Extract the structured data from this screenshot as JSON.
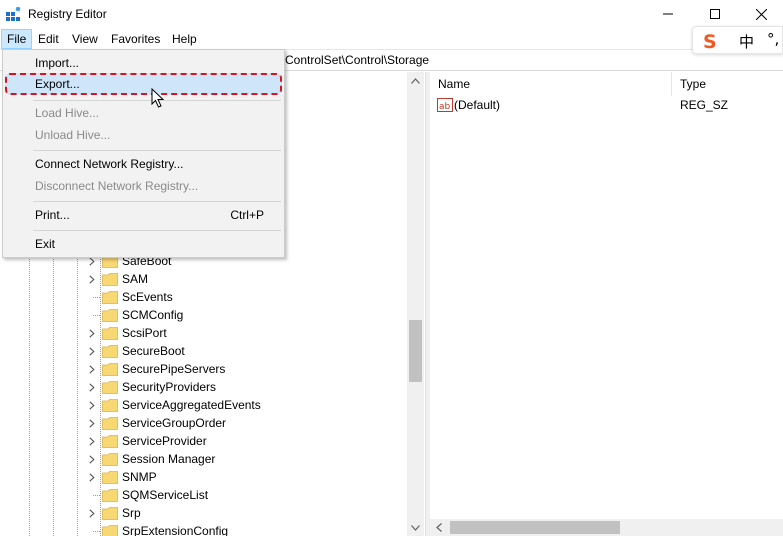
{
  "window": {
    "title": "Registry Editor"
  },
  "menubar": {
    "items": [
      "File",
      "Edit",
      "View",
      "Favorites",
      "Help"
    ]
  },
  "ime": {
    "logo": "S",
    "mode": "中",
    "punct": "°,"
  },
  "address": {
    "path_visible": "ControlSet\\Control\\Storage"
  },
  "file_menu": {
    "import": "Import...",
    "export": "Export...",
    "load_hive": "Load Hive...",
    "unload_hive": "Unload Hive...",
    "connect": "Connect Network Registry...",
    "disconnect": "Disconnect Network Registry...",
    "print": "Print...",
    "print_shortcut": "Ctrl+P",
    "exit": "Exit"
  },
  "tree": {
    "items": [
      {
        "label": "SafeBoot",
        "expandable": true
      },
      {
        "label": "SAM",
        "expandable": true
      },
      {
        "label": "ScEvents",
        "expandable": false
      },
      {
        "label": "SCMConfig",
        "expandable": false
      },
      {
        "label": "ScsiPort",
        "expandable": true
      },
      {
        "label": "SecureBoot",
        "expandable": true
      },
      {
        "label": "SecurePipeServers",
        "expandable": true
      },
      {
        "label": "SecurityProviders",
        "expandable": true
      },
      {
        "label": "ServiceAggregatedEvents",
        "expandable": true
      },
      {
        "label": "ServiceGroupOrder",
        "expandable": true
      },
      {
        "label": "ServiceProvider",
        "expandable": true
      },
      {
        "label": "Session Manager",
        "expandable": true
      },
      {
        "label": "SNMP",
        "expandable": true
      },
      {
        "label": "SQMServiceList",
        "expandable": false
      },
      {
        "label": "Srp",
        "expandable": true
      },
      {
        "label": "SrpExtensionConfig",
        "expandable": false
      }
    ]
  },
  "list": {
    "columns": {
      "name": "Name",
      "type": "Type"
    },
    "rows": [
      {
        "name": "(Default)",
        "type": "REG_SZ"
      }
    ]
  },
  "colors": {
    "menu_active": "#cce8ff",
    "highlight_border": "#d9141b",
    "folder": "#f8d775",
    "ab_icon": "#c0392b"
  }
}
